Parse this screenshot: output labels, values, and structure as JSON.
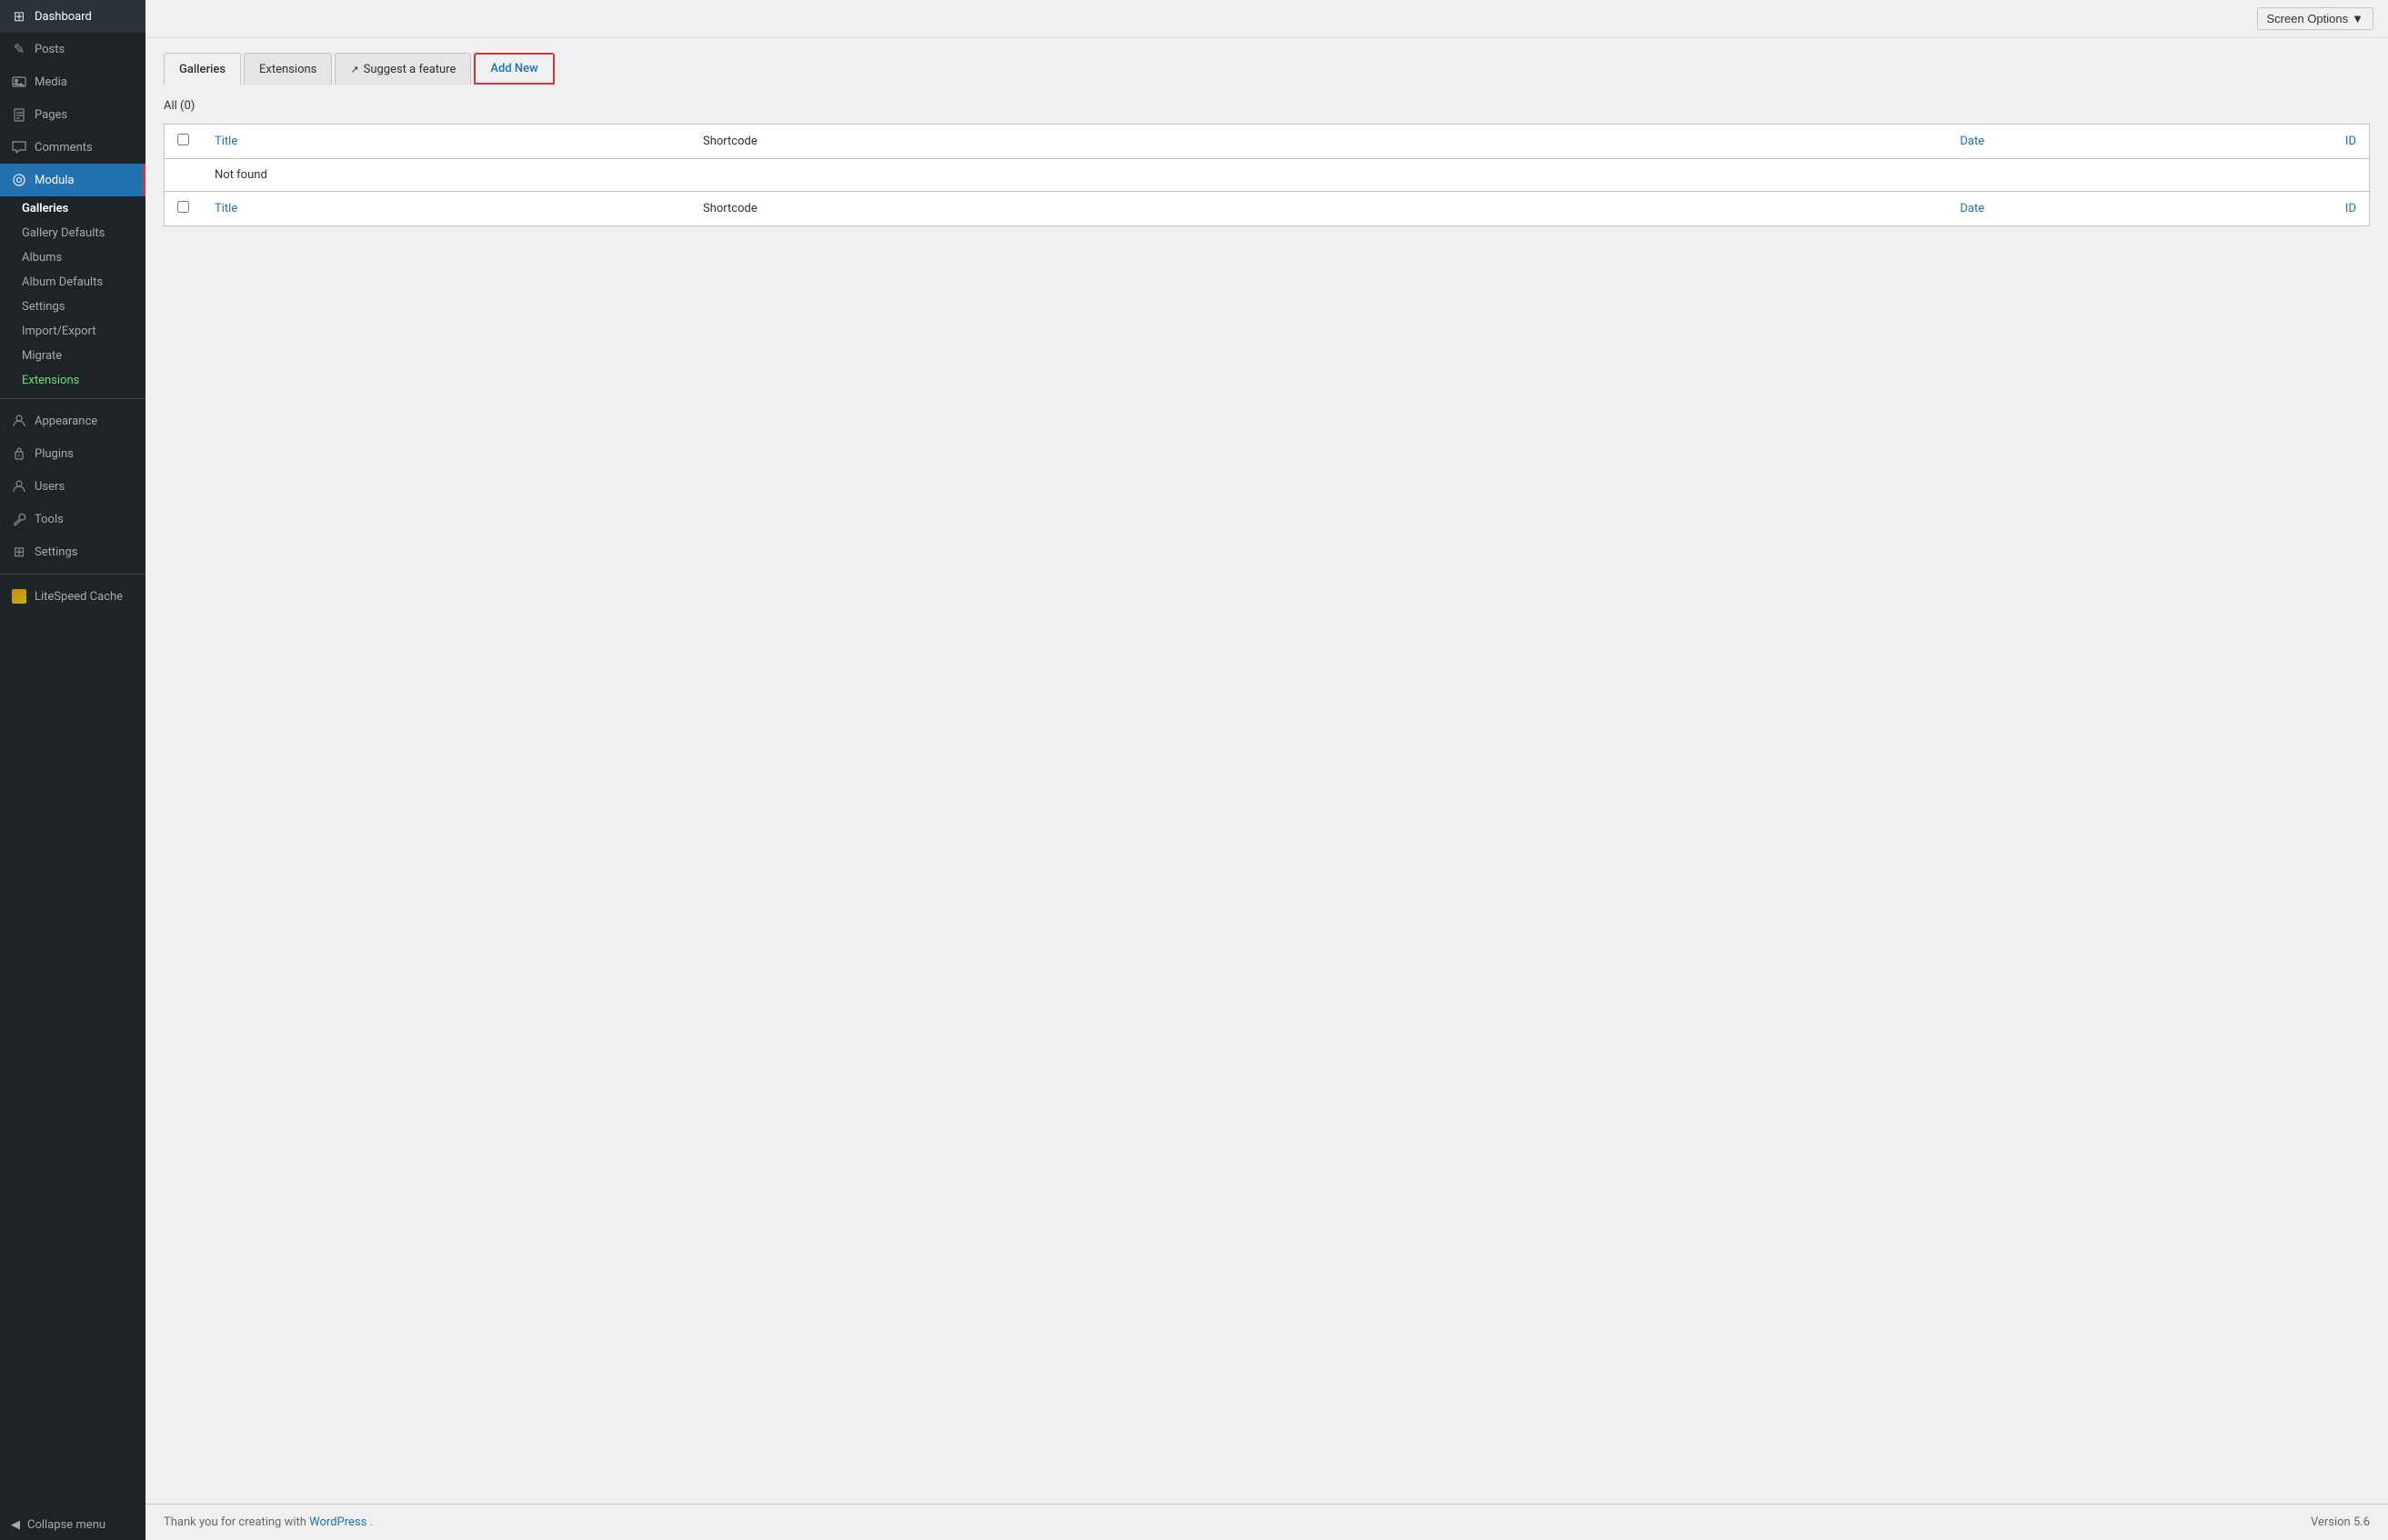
{
  "sidebar": {
    "items": [
      {
        "id": "dashboard",
        "label": "Dashboard",
        "icon": "⊞"
      },
      {
        "id": "posts",
        "label": "Posts",
        "icon": "✎"
      },
      {
        "id": "media",
        "label": "Media",
        "icon": "⊟"
      },
      {
        "id": "pages",
        "label": "Pages",
        "icon": "📄"
      },
      {
        "id": "comments",
        "label": "Comments",
        "icon": "💬"
      },
      {
        "id": "modula",
        "label": "Modula",
        "icon": "⚙"
      }
    ],
    "modula_subitems": [
      {
        "id": "galleries",
        "label": "Galleries",
        "active": true
      },
      {
        "id": "gallery-defaults",
        "label": "Gallery Defaults",
        "active": false
      },
      {
        "id": "albums",
        "label": "Albums",
        "active": false
      },
      {
        "id": "album-defaults",
        "label": "Album Defaults",
        "active": false
      },
      {
        "id": "settings",
        "label": "Settings",
        "active": false
      },
      {
        "id": "import-export",
        "label": "Import/Export",
        "active": false
      },
      {
        "id": "migrate",
        "label": "Migrate",
        "active": false
      },
      {
        "id": "extensions",
        "label": "Extensions",
        "active": false,
        "green": true
      }
    ],
    "bottom_items": [
      {
        "id": "appearance",
        "label": "Appearance",
        "icon": "🎨"
      },
      {
        "id": "plugins",
        "label": "Plugins",
        "icon": "🔌"
      },
      {
        "id": "users",
        "label": "Users",
        "icon": "👤"
      },
      {
        "id": "tools",
        "label": "Tools",
        "icon": "🔧"
      },
      {
        "id": "settings",
        "label": "Settings",
        "icon": "⊞"
      }
    ],
    "litespeed": {
      "label": "LiteSpeed Cache",
      "icon": "◇"
    },
    "collapse": {
      "label": "Collapse menu",
      "icon": "◀"
    }
  },
  "tabs": [
    {
      "id": "galleries",
      "label": "Galleries",
      "active": true
    },
    {
      "id": "extensions",
      "label": "Extensions",
      "active": false
    },
    {
      "id": "suggest",
      "label": "Suggest a feature",
      "active": false,
      "external": true
    },
    {
      "id": "add-new",
      "label": "Add New",
      "active": false,
      "highlight": true
    }
  ],
  "filter": {
    "all_label": "All",
    "count": "(0)"
  },
  "table": {
    "columns": [
      {
        "id": "title",
        "label": "Title",
        "link": true
      },
      {
        "id": "shortcode",
        "label": "Shortcode",
        "link": false
      },
      {
        "id": "date",
        "label": "Date",
        "link": true
      },
      {
        "id": "id",
        "label": "ID",
        "link": true
      }
    ],
    "rows": [],
    "not_found": "Not found"
  },
  "footer": {
    "thank_you_text": "Thank you for creating with ",
    "wp_link_text": "WordPress",
    "version_text": "Version 5.6"
  },
  "screen_options": {
    "label": "Screen Options",
    "arrow": "▼"
  }
}
